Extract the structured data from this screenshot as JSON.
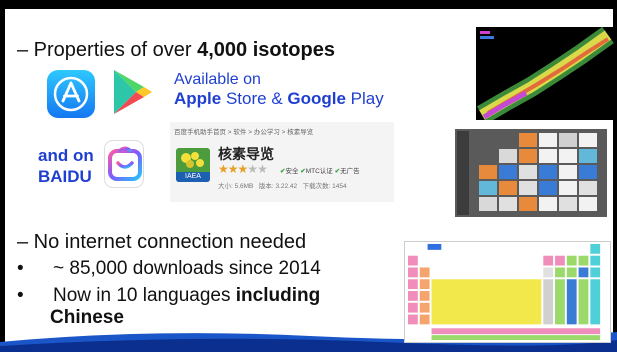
{
  "heading": {
    "prefix": "– Properties of over ",
    "bold": "4,000 isotopes"
  },
  "stores": {
    "line1": "Available on",
    "apple": "Apple",
    "middle": " Store & ",
    "google": "Google",
    "end": " Play"
  },
  "baidu": {
    "line1": "and on",
    "line2": "BAIDU"
  },
  "baidu_card": {
    "breadcrumb": "百度手机助手首页 > 软件 > 办公学习 > 核素导览",
    "icon_label": "IAEA",
    "title": "核素导览",
    "rating_stars": 2.5,
    "rating_max": 5,
    "badges": [
      "安全",
      "MTC认证",
      "无广告"
    ],
    "size": "大小: 5.6MB",
    "version": "版本: 3.22.42",
    "downloads": "下载次数: 1454"
  },
  "points": {
    "internet": "– No internet connection needed",
    "downloads": "~ 85,000 downloads since 2014",
    "languages_prefix": " Now in 10 languages ",
    "languages_bold1": "including",
    "languages_bold2": "Chinese"
  },
  "colors": {
    "accent_blue": "#1f3fd0",
    "wave_blue": "#1a56c8",
    "baidu_blue": "#1f3fd0"
  }
}
